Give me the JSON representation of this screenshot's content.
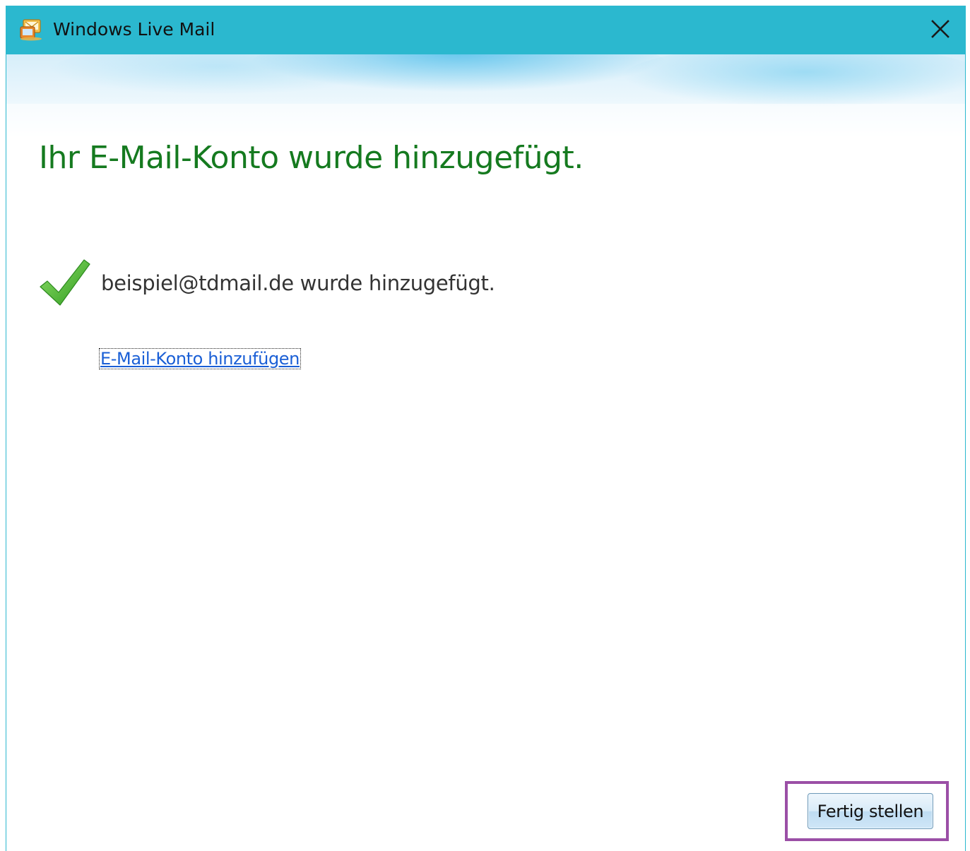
{
  "window": {
    "title": "Windows Live Mail",
    "icon": "windows-live-mail-icon",
    "close_icon": "close-icon"
  },
  "content": {
    "headline": "Ihr E-Mail-Konto wurde hinzugefügt.",
    "status_icon": "checkmark-icon",
    "status_text": "beispiel@tdmail.de wurde hinzugefügt.",
    "add_account_link": "E-Mail-Konto hinzufügen"
  },
  "footer": {
    "finish_button": "Fertig stellen"
  },
  "colors": {
    "titlebar": "#2bb8cf",
    "headline": "#157a1f",
    "link": "#1a5fd6",
    "highlight": "#9b4fa6",
    "check": "#3fae2a"
  }
}
